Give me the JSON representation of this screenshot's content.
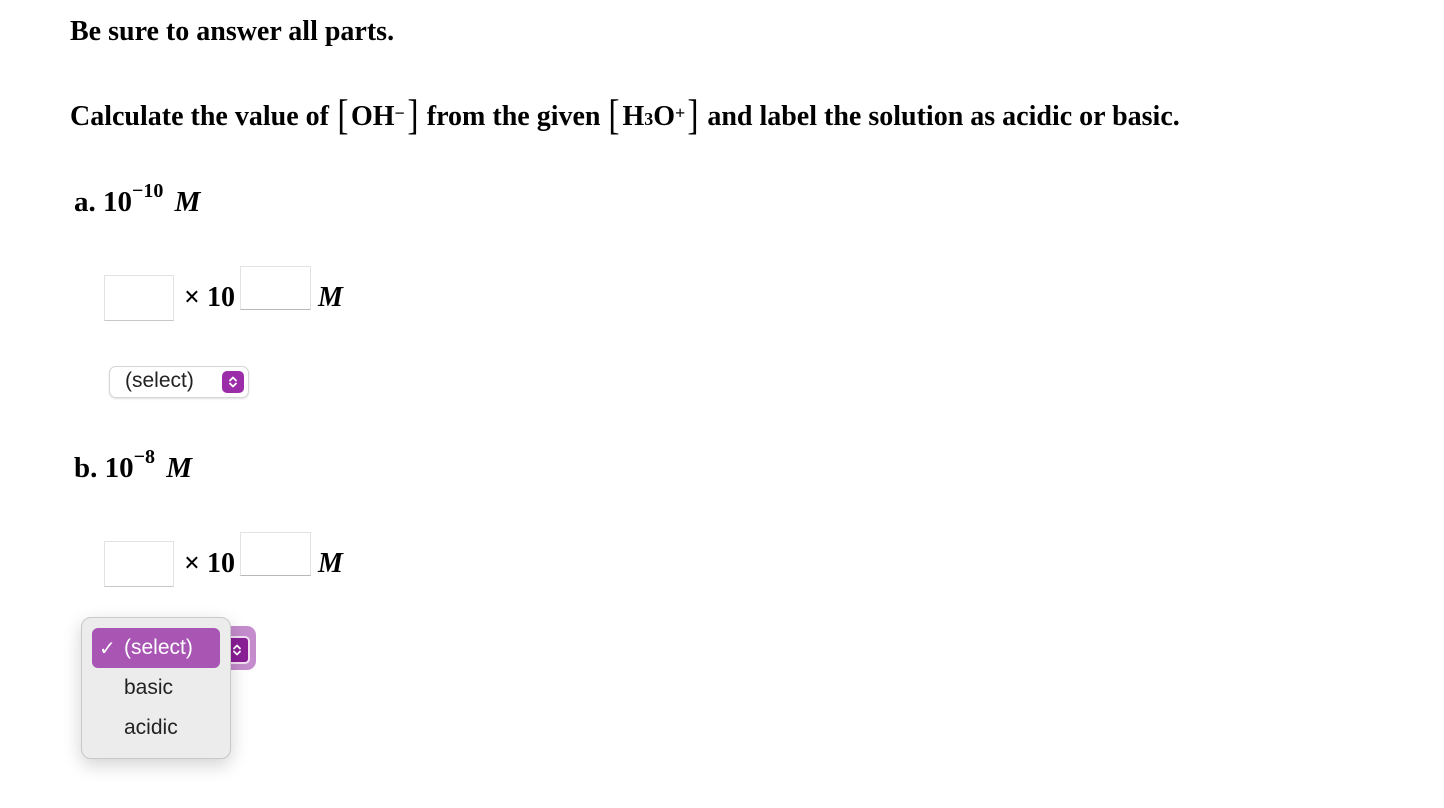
{
  "instruction": "Be sure to answer all parts.",
  "question": {
    "prefix": "Calculate the value of",
    "species1": {
      "base": "OH",
      "charge": "−"
    },
    "middle": "from the given",
    "species2": {
      "base": "H",
      "subscript": "3",
      "after": "O",
      "charge": "+"
    },
    "suffix": "and label the solution as acidic or basic."
  },
  "parts": [
    {
      "label": "a.",
      "base": "10",
      "exponent": "−10",
      "unit": "M",
      "answer": {
        "coefficient_value": "",
        "exponent_value": "",
        "times_label": "× 10",
        "unit": "M"
      },
      "select": {
        "value": "(select)"
      }
    },
    {
      "label": "b.",
      "base": "10",
      "exponent": "−8",
      "unit": "M",
      "answer": {
        "coefficient_value": "",
        "exponent_value": "",
        "times_label": "× 10",
        "unit": "M"
      },
      "select": {
        "value": "(select)",
        "open": true
      }
    }
  ],
  "dropdown": {
    "options": [
      {
        "label": "(select)",
        "selected": true,
        "check": "✓"
      },
      {
        "label": "basic",
        "selected": false
      },
      {
        "label": "acidic",
        "selected": false
      }
    ]
  },
  "colors": {
    "accent": "#9b2ea8",
    "option_highlight": "#a855b4"
  }
}
